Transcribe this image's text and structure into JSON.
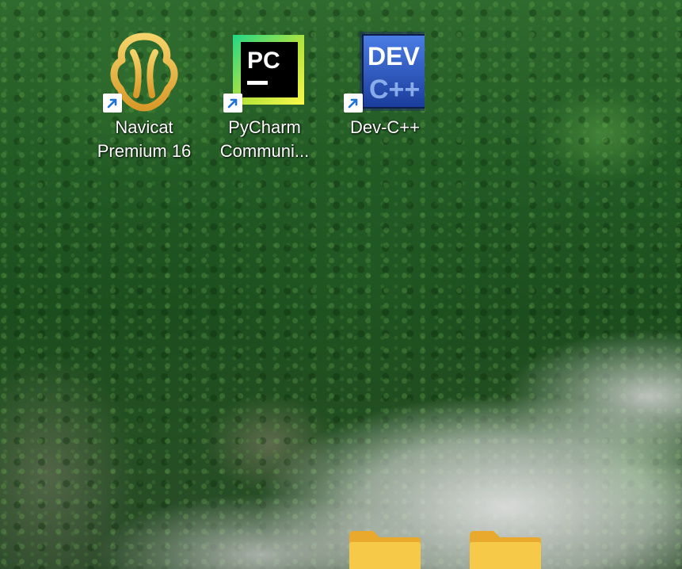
{
  "desktop": {
    "icons": [
      {
        "label_line1": "Navicat",
        "label_line2": "Premium 16",
        "icon": "navicat-icon"
      },
      {
        "label_line1": "PyCharm",
        "label_line2": "Communi...",
        "icon": "pycharm-icon",
        "logo_text": "PC"
      },
      {
        "label_line1": "Dev-C++",
        "label_line2": "",
        "icon": "devcpp-icon",
        "logo_text_top": "DEV",
        "logo_text_bottom": "C++"
      }
    ],
    "folders": [
      {
        "icon": "folder-icon"
      },
      {
        "icon": "folder-icon"
      }
    ]
  },
  "colors": {
    "navicat_gold": "#e9b94a",
    "pycharm_green": "#21d789",
    "pycharm_yellow": "#fcf84a",
    "devcpp_blue": "#2d58c7",
    "folder_yellow": "#f7c948",
    "label_text": "#ffffff"
  }
}
